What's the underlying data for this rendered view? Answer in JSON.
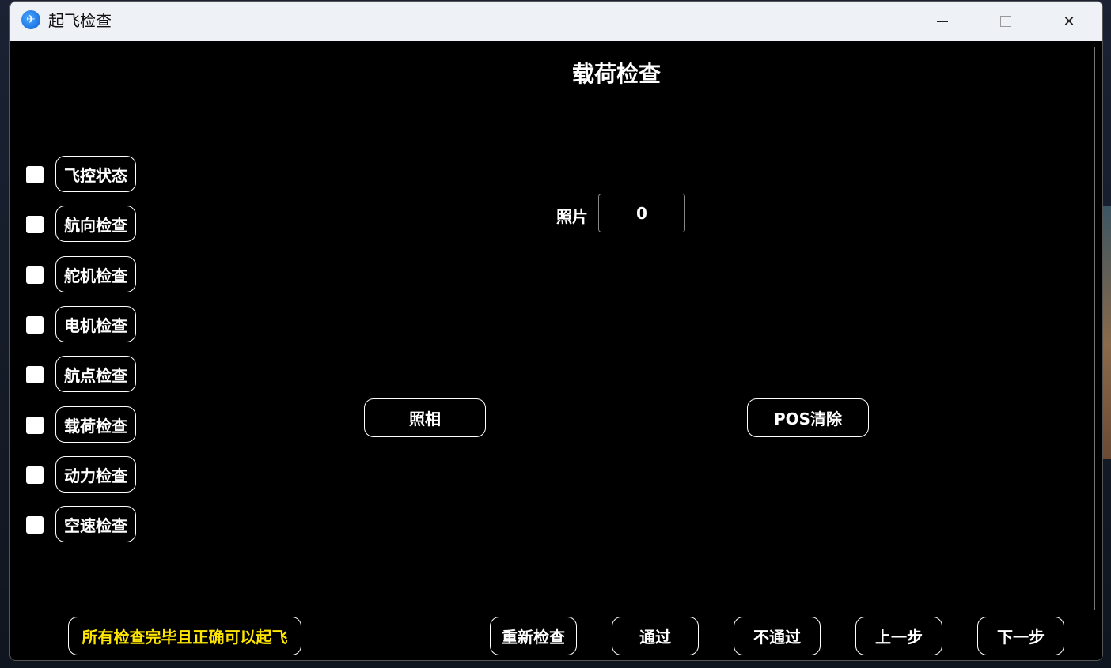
{
  "window": {
    "title": "起飞检查",
    "icon": "plane-app-icon"
  },
  "checklist": [
    {
      "label": "飞控状态",
      "checked": false
    },
    {
      "label": "航向检查",
      "checked": false
    },
    {
      "label": "舵机检查",
      "checked": false
    },
    {
      "label": "电机检查",
      "checked": false
    },
    {
      "label": "航点检查",
      "checked": false
    },
    {
      "label": "载荷检查",
      "checked": false
    },
    {
      "label": "动力检查",
      "checked": false
    },
    {
      "label": "空速检查",
      "checked": false
    }
  ],
  "panel": {
    "title": "载荷检查",
    "photo_label": "照片",
    "photo_count": "0",
    "take_photo_label": "照相",
    "pos_clear_label": "POS清除"
  },
  "footer": {
    "status_text": "所有检查完毕且正确可以起飞",
    "status_color": "#ffe600",
    "recheck_label": "重新检查",
    "pass_label": "通过",
    "fail_label": "不通过",
    "prev_label": "上一步",
    "next_label": "下一步"
  }
}
